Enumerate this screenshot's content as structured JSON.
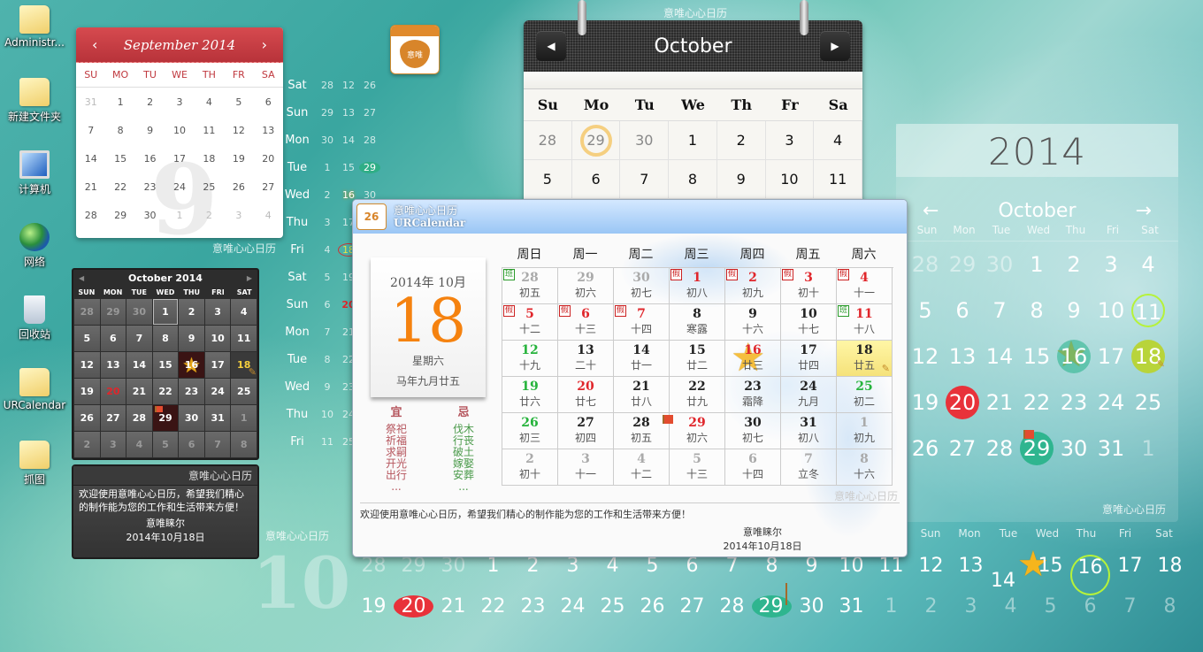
{
  "desktop_icons": [
    {
      "label": "Administr...",
      "icon": "user-folder-icon"
    },
    {
      "label": "新建文件夹",
      "icon": "folder-icon"
    },
    {
      "label": "计算机",
      "icon": "computer-icon"
    },
    {
      "label": "网络",
      "icon": "network-icon"
    },
    {
      "label": "回收站",
      "icon": "recycle-bin-icon"
    },
    {
      "label": "URCalendar",
      "icon": "folder-icon"
    },
    {
      "label": "抓图",
      "icon": "folder-icon"
    }
  ],
  "watermark": "意唯心心日历",
  "sep_calendar": {
    "title": "September 2014",
    "prev": "‹",
    "next": "›",
    "weekdays": [
      "SU",
      "MO",
      "TU",
      "WE",
      "TH",
      "FR",
      "SA"
    ],
    "bg_digit": "9",
    "days": [
      [
        "31",
        "1",
        "2",
        "3",
        "4",
        "5",
        "6"
      ],
      [
        "7",
        "8",
        "9",
        "10",
        "11",
        "12",
        "13"
      ],
      [
        "14",
        "15",
        "16",
        "17",
        "18",
        "19",
        "20"
      ],
      [
        "21",
        "22",
        "23",
        "24",
        "25",
        "26",
        "27"
      ],
      [
        "28",
        "29",
        "30",
        "1",
        "2",
        "3",
        "4"
      ]
    ],
    "muted": [
      [
        0,
        0
      ],
      [
        4,
        3
      ],
      [
        4,
        4
      ],
      [
        4,
        5
      ],
      [
        4,
        6
      ]
    ]
  },
  "vertical_strip": {
    "rows": [
      {
        "day": "Sat",
        "a": "28",
        "b": "12",
        "c": "26"
      },
      {
        "day": "Sun",
        "a": "29",
        "b": "13",
        "c": "27"
      },
      {
        "day": "Mon",
        "a": "30",
        "b": "14",
        "c": "28"
      },
      {
        "day": "Tue",
        "a": "1",
        "b": "15",
        "c": "29"
      },
      {
        "day": "Wed",
        "a": "2",
        "b": "16",
        "c": "30"
      },
      {
        "day": "Thu",
        "a": "3",
        "b": "17",
        "c": ""
      },
      {
        "day": "Fri",
        "a": "4",
        "b": "18",
        "c": ""
      },
      {
        "day": "Sat",
        "a": "5",
        "b": "19",
        "c": ""
      },
      {
        "day": "Sun",
        "a": "6",
        "b": "20",
        "c": ""
      },
      {
        "day": "Mon",
        "a": "7",
        "b": "21",
        "c": ""
      },
      {
        "day": "Tue",
        "a": "8",
        "b": "22",
        "c": ""
      },
      {
        "day": "Wed",
        "a": "9",
        "b": "23",
        "c": ""
      },
      {
        "day": "Thu",
        "a": "10",
        "b": "24",
        "c": ""
      },
      {
        "day": "Fri",
        "a": "11",
        "b": "25",
        "c": ""
      }
    ]
  },
  "dark_calendar": {
    "title": "October  2014",
    "prev": "◀",
    "next": "▶",
    "weekdays": [
      "SUN",
      "MON",
      "TUE",
      "WED",
      "THU",
      "FRI",
      "SAT"
    ],
    "days": [
      [
        "28",
        "29",
        "30",
        "1",
        "2",
        "3",
        "4"
      ],
      [
        "5",
        "6",
        "7",
        "8",
        "9",
        "10",
        "11"
      ],
      [
        "12",
        "13",
        "14",
        "15",
        "16",
        "17",
        "18"
      ],
      [
        "19",
        "20",
        "21",
        "22",
        "23",
        "24",
        "25"
      ],
      [
        "26",
        "27",
        "28",
        "29",
        "30",
        "31",
        "1"
      ],
      [
        "2",
        "3",
        "4",
        "5",
        "6",
        "7",
        "8"
      ]
    ]
  },
  "dark_note": {
    "title": "意唯心心日历",
    "message": "欢迎使用意唯心心日历，希望我们精心的制作能为您的工作和生活带来方便！",
    "author": "意唯睐尔",
    "date": "2014年10月18日"
  },
  "app_icon": {
    "label": "意唯"
  },
  "oct_top": {
    "title": "October",
    "prev": "◀",
    "next": "▶",
    "watermark": "意唯心心日历",
    "weekdays": [
      "Su",
      "Mo",
      "Tu",
      "We",
      "Th",
      "Fr",
      "Sa"
    ],
    "days": [
      [
        "28",
        "29",
        "30",
        "1",
        "2",
        "3",
        "4"
      ],
      [
        "5",
        "6",
        "7",
        "8",
        "9",
        "10",
        "11"
      ]
    ]
  },
  "main_window": {
    "title_cn": "意唯心心日历",
    "title_en": "URCalendar",
    "icon_label": "26",
    "pad": {
      "year_month": "2014年 10月",
      "day": "18",
      "weekday": "星期六",
      "lunar": "马年九月廿五"
    },
    "yi": {
      "label": "宜",
      "items": [
        "祭祀",
        "祈福",
        "求嗣",
        "开光",
        "出行"
      ],
      "more": "..."
    },
    "ji": {
      "label": "忌",
      "items": [
        "伐木",
        "行丧",
        "破土",
        "嫁娶",
        "安葬"
      ],
      "more": "..."
    },
    "weekdays": [
      "周日",
      "周一",
      "周二",
      "周三",
      "周四",
      "周五",
      "周六"
    ],
    "cells": [
      {
        "d": "28",
        "l": "初五",
        "c": "gry",
        "tag": "班"
      },
      {
        "d": "29",
        "l": "初六",
        "c": "gry"
      },
      {
        "d": "30",
        "l": "初七",
        "c": "gry"
      },
      {
        "d": "1",
        "l": "初八",
        "c": "red",
        "tag": "假"
      },
      {
        "d": "2",
        "l": "初九",
        "c": "red",
        "tag": "假"
      },
      {
        "d": "3",
        "l": "初十",
        "c": "red",
        "tag": "假"
      },
      {
        "d": "4",
        "l": "十一",
        "c": "red",
        "tag": "假"
      },
      {
        "d": "5",
        "l": "十二",
        "c": "red",
        "tag": "假"
      },
      {
        "d": "6",
        "l": "十三",
        "c": "red",
        "tag": "假"
      },
      {
        "d": "7",
        "l": "十四",
        "c": "red",
        "tag": "假"
      },
      {
        "d": "8",
        "l": "寒露",
        "c": ""
      },
      {
        "d": "9",
        "l": "十六",
        "c": ""
      },
      {
        "d": "10",
        "l": "十七",
        "c": ""
      },
      {
        "d": "11",
        "l": "十八",
        "c": "red",
        "tag": "班"
      },
      {
        "d": "12",
        "l": "十九",
        "c": "grn"
      },
      {
        "d": "13",
        "l": "二十",
        "c": ""
      },
      {
        "d": "14",
        "l": "廿一",
        "c": ""
      },
      {
        "d": "15",
        "l": "廿二",
        "c": ""
      },
      {
        "d": "16",
        "l": "廿三",
        "c": "red",
        "star": true
      },
      {
        "d": "17",
        "l": "廿四",
        "c": ""
      },
      {
        "d": "18",
        "l": "廿五",
        "c": "",
        "sel": true
      },
      {
        "d": "19",
        "l": "廿六",
        "c": "grn"
      },
      {
        "d": "20",
        "l": "廿七",
        "c": "red"
      },
      {
        "d": "21",
        "l": "廿八",
        "c": ""
      },
      {
        "d": "22",
        "l": "廿九",
        "c": ""
      },
      {
        "d": "23",
        "l": "霜降",
        "c": ""
      },
      {
        "d": "24",
        "l": "九月",
        "c": ""
      },
      {
        "d": "25",
        "l": "初二",
        "c": "grn"
      },
      {
        "d": "26",
        "l": "初三",
        "c": "grn"
      },
      {
        "d": "27",
        "l": "初四",
        "c": ""
      },
      {
        "d": "28",
        "l": "初五",
        "c": ""
      },
      {
        "d": "29",
        "l": "初六",
        "c": "red",
        "flag": true
      },
      {
        "d": "30",
        "l": "初七",
        "c": ""
      },
      {
        "d": "31",
        "l": "初八",
        "c": ""
      },
      {
        "d": "1",
        "l": "初九",
        "c": "gry"
      },
      {
        "d": "2",
        "l": "初十",
        "c": "gry"
      },
      {
        "d": "3",
        "l": "十一",
        "c": "gry"
      },
      {
        "d": "4",
        "l": "十二",
        "c": "gry"
      },
      {
        "d": "5",
        "l": "十三",
        "c": "gry"
      },
      {
        "d": "6",
        "l": "十四",
        "c": "gry"
      },
      {
        "d": "7",
        "l": "立冬",
        "c": "gry"
      },
      {
        "d": "8",
        "l": "十六",
        "c": "gry"
      }
    ],
    "watermark": "意唯心心日历",
    "message": "欢迎使用意唯心心日历，希望我们精心的制作能为您的工作和生活带来方便！",
    "author": "意唯睐尔",
    "date": "2014年10月18日"
  },
  "glass_calendar": {
    "year": "2014",
    "month": "October",
    "prev": "←",
    "next": "→",
    "weekdays": [
      "Sun",
      "Mon",
      "Tue",
      "Wed",
      "Thu",
      "Fri",
      "Sat"
    ],
    "days": [
      [
        "28",
        "29",
        "30",
        "1",
        "2",
        "3",
        "4"
      ],
      [
        "5",
        "6",
        "7",
        "8",
        "9",
        "10",
        "11"
      ],
      [
        "12",
        "13",
        "14",
        "15",
        "16",
        "17",
        "18"
      ],
      [
        "19",
        "20",
        "21",
        "22",
        "23",
        "24",
        "25"
      ],
      [
        "26",
        "27",
        "28",
        "29",
        "30",
        "31",
        "1"
      ]
    ],
    "watermark": "意唯心心日历"
  },
  "bottom_strip": {
    "month_digit": "10",
    "watermark": "意唯心心日历",
    "weekdays": [
      "Sun",
      "Mon",
      "Tue",
      "Wed",
      "Thu",
      "Fri",
      "Sat"
    ],
    "row1": [
      "28",
      "29",
      "30",
      "1",
      "2",
      "3",
      "4",
      "5",
      "6",
      "7",
      "8",
      "9",
      "10",
      "11",
      "12",
      "13",
      "14",
      "15",
      "16",
      "17",
      "18"
    ],
    "row2": [
      "19",
      "20",
      "21",
      "22",
      "23",
      "24",
      "25",
      "26",
      "27",
      "28",
      "29",
      "30",
      "31",
      "1",
      "2",
      "3",
      "4",
      "5",
      "6",
      "7",
      "8"
    ]
  },
  "colors": {
    "accent_red": "#e0262b",
    "holiday_green": "#26b33c",
    "today_orange": "#f5820f",
    "star_gold": "#f6b51c"
  }
}
